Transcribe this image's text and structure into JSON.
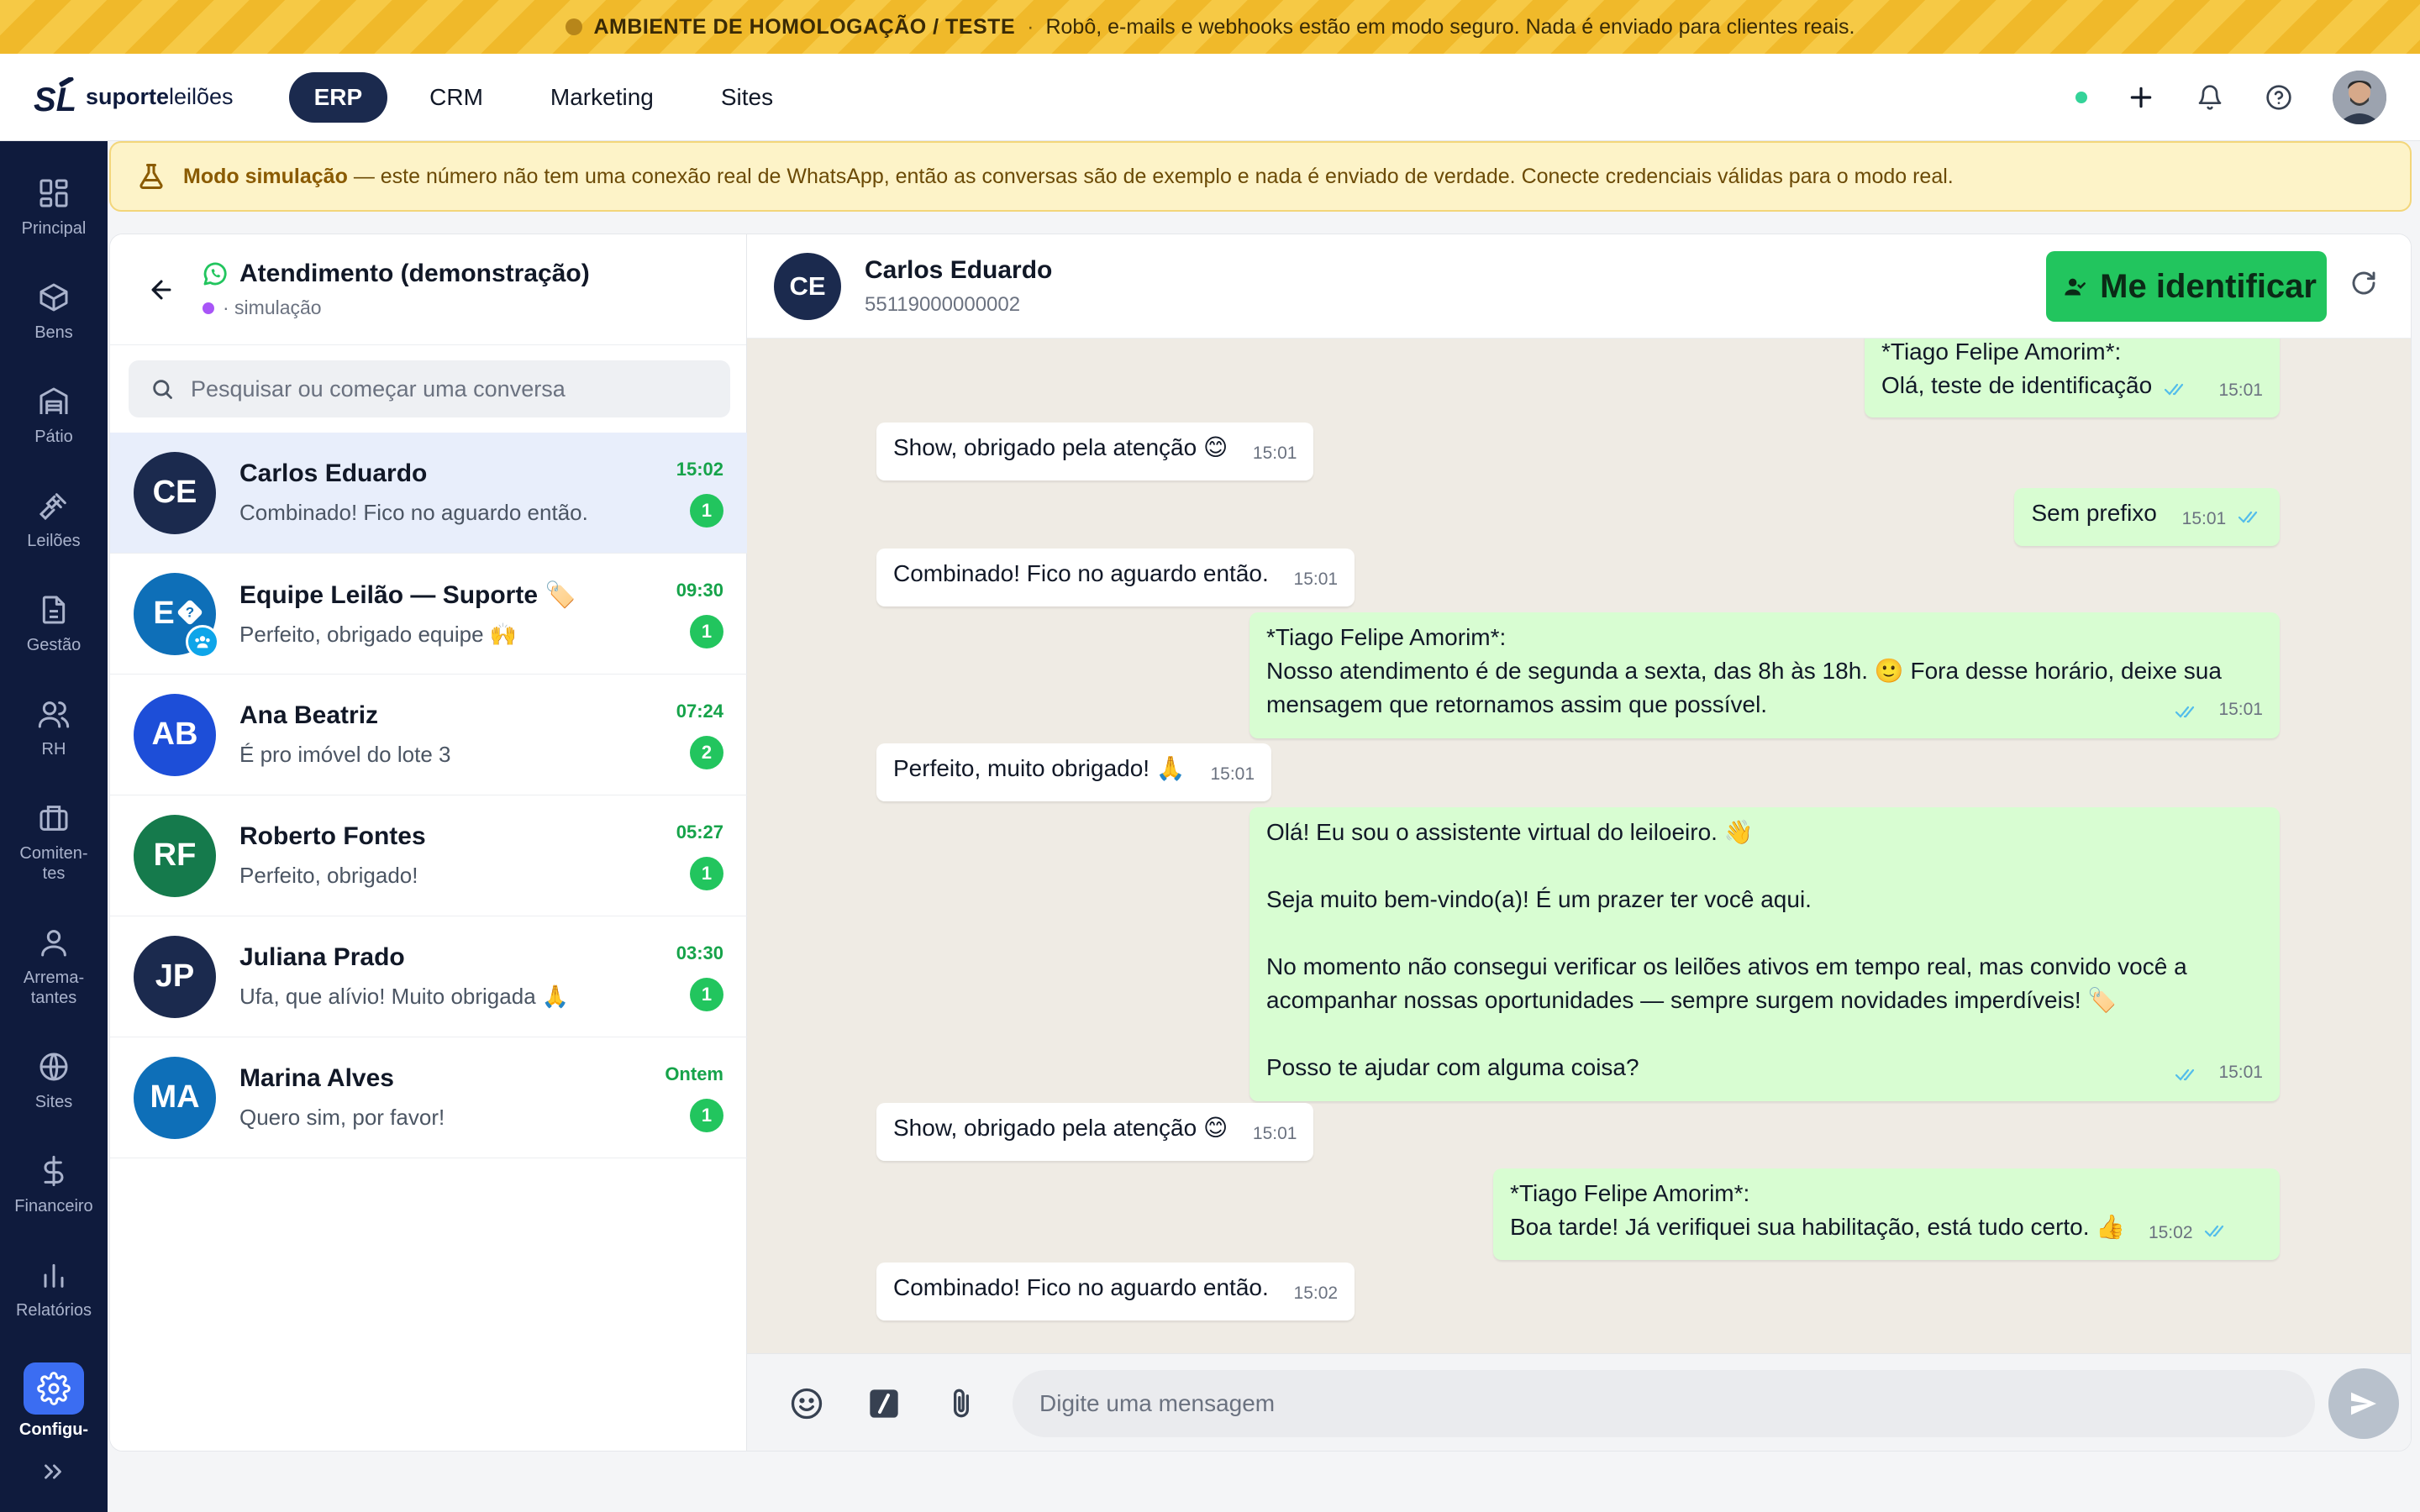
{
  "env_banner": {
    "title": "AMBIENTE DE HOMOLOGAÇÃO / TESTE",
    "separator": "·",
    "message": "Robô, e-mails e webhooks estão em modo seguro. Nada é enviado para clientes reais."
  },
  "header": {
    "logo_bold": "suporte",
    "logo_light": "leilões",
    "nav": [
      {
        "label": "ERP",
        "active": true
      },
      {
        "label": "CRM",
        "active": false
      },
      {
        "label": "Marketing",
        "active": false
      },
      {
        "label": "Sites",
        "active": false
      }
    ]
  },
  "sidebar": {
    "items": [
      {
        "label": "Principal",
        "icon": "grid-icon"
      },
      {
        "label": "Bens",
        "icon": "box-icon"
      },
      {
        "label": "Pátio",
        "icon": "warehouse-icon"
      },
      {
        "label": "Leilões",
        "icon": "gavel-icon"
      },
      {
        "label": "Gestão",
        "icon": "document-icon"
      },
      {
        "label": "RH",
        "icon": "users-icon"
      },
      {
        "label": "Comiten-\ntes",
        "icon": "briefcase-icon"
      },
      {
        "label": "Arrema-\ntantes",
        "icon": "user-icon"
      },
      {
        "label": "Sites",
        "icon": "globe-icon"
      },
      {
        "label": "Financeiro",
        "icon": "dollar-icon"
      },
      {
        "label": "Relatórios",
        "icon": "bar-chart-icon"
      },
      {
        "label": "Configu-",
        "icon": "gear-icon",
        "active": true
      }
    ]
  },
  "sim_notice": {
    "bold": "Modo simulação",
    "text": " — este número não tem uma conexão real de WhatsApp, então as conversas são de exemplo e nada é enviado de verdade. Conecte credenciais válidas para o modo real."
  },
  "list": {
    "title": "Atendimento (demonstração)",
    "subtitle": "· simulação",
    "search_placeholder": "Pesquisar ou começar uma conversa",
    "conversations": [
      {
        "initials": "CE",
        "name": "Carlos Eduardo",
        "preview": "Combinado! Fico no aguardo então.",
        "time": "15:02",
        "unread": "1",
        "color": "#1b2a4e",
        "active": true
      },
      {
        "initials": "E",
        "name": "Equipe Leilão — Suporte 🏷️",
        "preview": "Perfeito, obrigado equipe 🙌",
        "time": "09:30",
        "unread": "1",
        "color": "#0e6fb8",
        "group": true
      },
      {
        "initials": "AB",
        "name": "Ana Beatriz",
        "preview": "É pro imóvel do lote 3",
        "time": "07:24",
        "unread": "2",
        "color": "#1d4ed8"
      },
      {
        "initials": "RF",
        "name": "Roberto Fontes",
        "preview": "Perfeito, obrigado!",
        "time": "05:27",
        "unread": "1",
        "color": "#157a4c"
      },
      {
        "initials": "JP",
        "name": "Juliana Prado",
        "preview": "Ufa, que alívio! Muito obrigada 🙏",
        "time": "03:30",
        "unread": "1",
        "color": "#1b2a4e"
      },
      {
        "initials": "MA",
        "name": "Marina Alves",
        "preview": "Quero sim, por favor!",
        "time": "Ontem",
        "unread": "1",
        "color": "#0e6fb8"
      }
    ]
  },
  "chat": {
    "peer_initials": "CE",
    "peer_name": "Carlos Eduardo",
    "peer_phone": "55119000000002",
    "identify_label": "Me identificar",
    "composer_placeholder": "Digite uma mensagem",
    "messages": [
      {
        "dir": "out",
        "text": "*Tiago Felipe Amorim*:\nOlá, teste de identificação",
        "time": "15:01"
      },
      {
        "dir": "in",
        "text": "Show, obrigado pela atenção 😊",
        "time": "15:01"
      },
      {
        "dir": "out",
        "text": "Sem prefixo",
        "time": "15:01"
      },
      {
        "dir": "in",
        "text": "Combinado! Fico no aguardo então.",
        "time": "15:01"
      },
      {
        "dir": "out",
        "text": "*Tiago Felipe Amorim*:\nNosso atendimento é de segunda a sexta, das 8h às 18h. 🙂  Fora desse horário, deixe sua mensagem que retornamos assim que possível.",
        "time": "15:01"
      },
      {
        "dir": "in",
        "text": "Perfeito, muito obrigado! 🙏",
        "time": "15:01"
      },
      {
        "dir": "out",
        "text": "Olá! Eu sou o assistente virtual do leiloeiro. 👋\n\nSeja muito bem-vindo(a)! É um prazer ter você aqui.\n\nNo momento não consegui verificar os leilões ativos em tempo real, mas convido você a acompanhar nossas oportunidades — sempre surgem novidades imperdíveis! 🏷️\n\nPosso te ajudar com alguma coisa?",
        "time": "15:01"
      },
      {
        "dir": "in",
        "text": "Show, obrigado pela atenção 😊",
        "time": "15:01"
      },
      {
        "dir": "out",
        "text": "*Tiago Felipe Amorim*:\nBoa tarde! Já verifiquei sua habilitação, está tudo certo. 👍",
        "time": "15:02"
      },
      {
        "dir": "in",
        "text": "Combinado! Fico no aguardo então.",
        "time": "15:02"
      }
    ]
  }
}
